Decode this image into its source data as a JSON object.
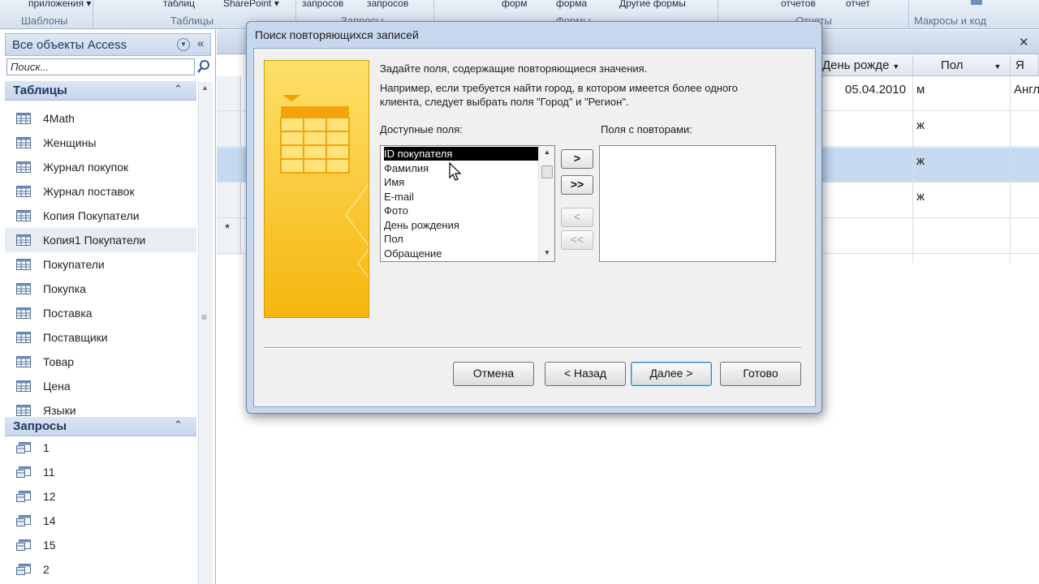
{
  "ribbon": {
    "groups": [
      {
        "btn": "приложения ▾",
        "cap": "Шаблоны"
      },
      {
        "btn": "таблиц",
        "btn2": "SharePoint ▾",
        "cap": "Таблицы"
      },
      {
        "btn": "запросов",
        "btn2": "запросов",
        "cap": "Запросы"
      },
      {
        "btn": "форм",
        "btn2": "форма",
        "btn3": "Другие формы",
        "cap": "Формы"
      },
      {
        "btn": "отчетов",
        "btn2": "отчет",
        "cap": "Отчеты"
      },
      {
        "btn": "",
        "cap": "Макросы и код"
      }
    ]
  },
  "nav": {
    "title": "Все объекты Access",
    "search_placeholder": "Поиск...",
    "tables_header": "Таблицы",
    "tables": [
      "4Math",
      "Женщины",
      "Журнал покупок",
      "Журнал поставок",
      "Копия Покупатели",
      "Копия1 Покупатели",
      "Покупатели",
      "Покупка",
      "Поставка",
      "Поставщики",
      "Товар",
      "Цена",
      "Языки"
    ],
    "selected_table_index": 5,
    "queries_header": "Запросы",
    "queries": [
      "1",
      "11",
      "12",
      "14",
      "15",
      "2"
    ]
  },
  "sheet": {
    "columns": [
      "День рожде",
      "Пол",
      "Я"
    ],
    "rows": [
      {
        "birthday": "05.04.2010",
        "sex": "м",
        "lang": "Англ"
      },
      {
        "birthday": "",
        "sex": "ж",
        "lang": ""
      },
      {
        "birthday": "",
        "sex": "ж",
        "lang": ""
      },
      {
        "birthday": "",
        "sex": "ж",
        "lang": ""
      }
    ],
    "new_row_marker": "*"
  },
  "dialog": {
    "title": "Поиск повторяющихся записей",
    "intro": "Задайте поля, содержащие повторяющиеся значения.",
    "example_line1": "Например, если требуется найти город, в котором имеется более одного",
    "example_line2": "клиента, следует выбрать поля \"Город\" и \"Регион\".",
    "available_label": "Доступные поля:",
    "duplicates_label": "Поля с повторами:",
    "available_fields": [
      "ID покупателя",
      "Фамилия",
      "Имя",
      "E-mail",
      "Фото",
      "День рождения",
      "Пол",
      "Обращение"
    ],
    "selected_field_index": 0,
    "move_one": ">",
    "move_all": ">>",
    "remove_one": "<",
    "remove_all": "<<",
    "cancel": "Отмена",
    "back": "< Назад",
    "next": "Далее >",
    "finish": "Готово"
  }
}
